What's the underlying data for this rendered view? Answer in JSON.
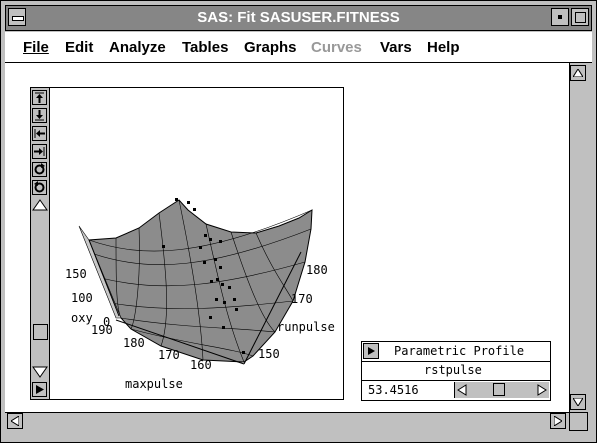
{
  "window": {
    "title": "SAS: Fit SASUSER.FITNESS"
  },
  "menu": {
    "file": "File",
    "edit": "Edit",
    "analyze": "Analyze",
    "tables": "Tables",
    "graphs": "Graphs",
    "curves": "Curves",
    "vars": "Vars",
    "help": "Help"
  },
  "plot": {
    "z_axis_label": "oxy",
    "z_ticks": [
      "150",
      "100",
      "0"
    ],
    "x_axis_label": "maxpulse",
    "x_ticks": [
      "190",
      "180",
      "170",
      "160"
    ],
    "y_axis_label": "runpulse",
    "y_ticks": [
      "180",
      "170",
      "150"
    ]
  },
  "profile": {
    "title": "Parametric Profile",
    "variable": "rstpulse",
    "value": "53.4516",
    "slider_fraction": 0.45
  },
  "colors": {
    "surface": "#8c8c8c",
    "grid": "#000000",
    "titlebar": "#868686"
  }
}
